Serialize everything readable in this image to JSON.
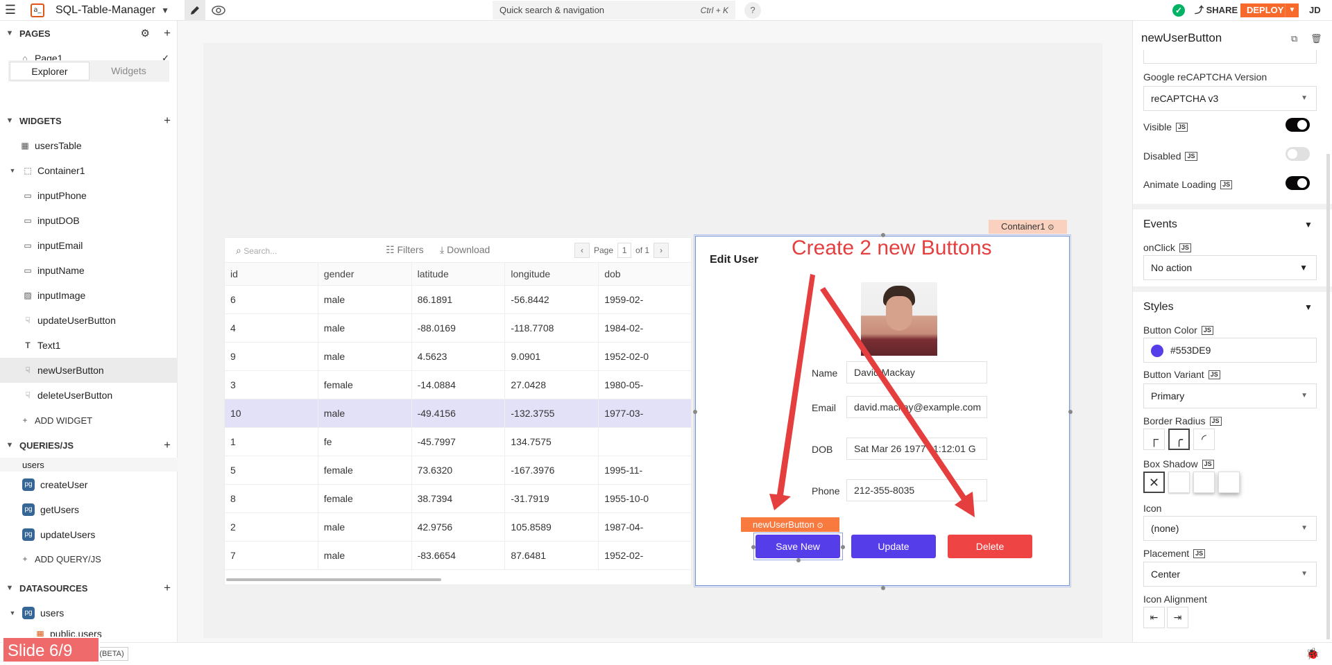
{
  "topbar": {
    "app_name": "SQL-Table-Manager",
    "search_label": "Quick search & navigation",
    "search_shortcut": "Ctrl + K",
    "help": "?",
    "share": "SHARE",
    "deploy": "DEPLOY",
    "user_initials": "JD"
  },
  "pages": {
    "title": "PAGES",
    "items": [
      {
        "label": "Page1"
      }
    ]
  },
  "tabs": {
    "explorer": "Explorer",
    "widgets": "Widgets"
  },
  "widgets": {
    "title": "WIDGETS",
    "items": [
      {
        "label": "usersTable"
      },
      {
        "label": "Container1"
      },
      {
        "label": "inputPhone"
      },
      {
        "label": "inputDOB"
      },
      {
        "label": "inputEmail"
      },
      {
        "label": "inputName"
      },
      {
        "label": "inputImage"
      },
      {
        "label": "updateUserButton"
      },
      {
        "label": "Text1"
      },
      {
        "label": "newUserButton"
      },
      {
        "label": "deleteUserButton"
      }
    ],
    "add": "ADD WIDGET"
  },
  "queries": {
    "title": "QUERIES/JS",
    "group": "users",
    "items": [
      {
        "label": "createUser"
      },
      {
        "label": "getUsers"
      },
      {
        "label": "updateUsers"
      }
    ],
    "add": "ADD QUERY/JS"
  },
  "datasources": {
    "title": "DATASOURCES",
    "items": [
      {
        "label": "users"
      },
      {
        "label": "public.users"
      }
    ]
  },
  "table": {
    "search_placeholder": "Search...",
    "filters": "Filters",
    "download": "Download",
    "page_label": "Page",
    "page_num": "1",
    "page_of": "of 1",
    "columns": [
      "id",
      "gender",
      "latitude",
      "longitude",
      "dob"
    ],
    "rows": [
      [
        "6",
        "male",
        "86.1891",
        "-56.8442",
        "1959-02-"
      ],
      [
        "4",
        "male",
        "-88.0169",
        "-118.7708",
        "1984-02-"
      ],
      [
        "9",
        "male",
        "4.5623",
        "9.0901",
        "1952-02-0"
      ],
      [
        "3",
        "female",
        "-14.0884",
        "27.0428",
        "1980-05-"
      ],
      [
        "10",
        "male",
        "-49.4156",
        "-132.3755",
        "1977-03-"
      ],
      [
        "1",
        "fe",
        "-45.7997",
        "134.7575",
        ""
      ],
      [
        "5",
        "female",
        "73.6320",
        "-167.3976",
        "1995-11-"
      ],
      [
        "8",
        "female",
        "38.7394",
        "-31.7919",
        "1955-10-0"
      ],
      [
        "2",
        "male",
        "42.9756",
        "105.8589",
        "1987-04-"
      ],
      [
        "7",
        "male",
        "-83.6654",
        "87.6481",
        "1952-02-"
      ]
    ],
    "selected_row": 4
  },
  "container": {
    "tag": "Container1",
    "title": "Edit User",
    "fields": [
      {
        "label": "Name",
        "value": "David Mackay"
      },
      {
        "label": "Email",
        "value": "david.mackay@example.com"
      },
      {
        "label": "DOB",
        "value": "Sat Mar 26 1977 11:12:01 G"
      },
      {
        "label": "Phone",
        "value": "212-355-8035"
      }
    ],
    "buttons": {
      "save_new": "Save New",
      "update": "Update",
      "delete": "Delete"
    },
    "selected_tag": "newUserButton"
  },
  "annotation": {
    "text": "Create 2 new Buttons",
    "color": "#e53e3e"
  },
  "props": {
    "widget_name": "newUserButton",
    "recaptcha_label": "Google reCAPTCHA Version",
    "recaptcha_value": "reCAPTCHA v3",
    "visible_label": "Visible",
    "visible": true,
    "disabled_label": "Disabled",
    "disabled": false,
    "animate_label": "Animate Loading",
    "animate": true,
    "events_title": "Events",
    "onclick_label": "onClick",
    "onclick_value": "No action",
    "styles_title": "Styles",
    "button_color_label": "Button Color",
    "button_color": "#553DE9",
    "variant_label": "Button Variant",
    "variant_value": "Primary",
    "radius_label": "Border Radius",
    "shadow_label": "Box Shadow",
    "icon_label": "Icon",
    "icon_value": "(none)",
    "placement_label": "Placement",
    "placement_value": "Center",
    "icon_align_label": "Icon Alignment",
    "js": "JS"
  },
  "bottom": {
    "slide": "Slide 6/9",
    "beta": "(BETA)"
  },
  "colors": {
    "accent": "#553de9",
    "danger": "#ef4444",
    "brand": "#f86a2b"
  }
}
